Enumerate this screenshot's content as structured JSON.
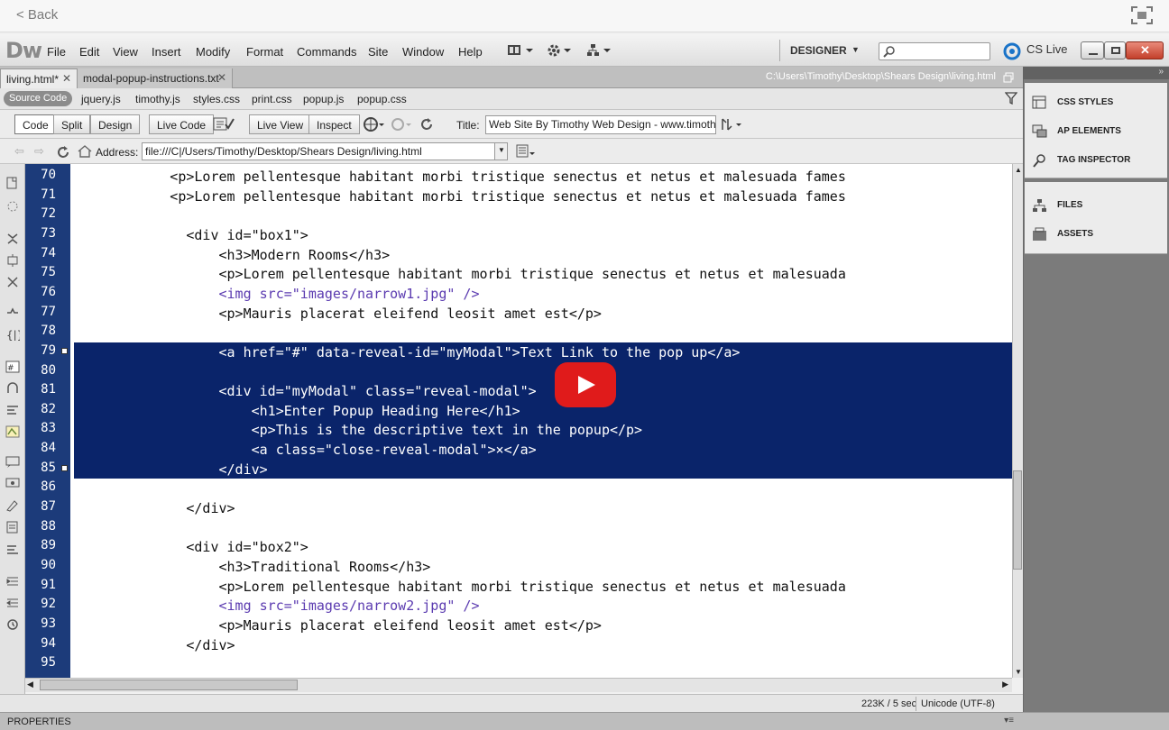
{
  "back_label": "< Back",
  "menu": [
    "File",
    "Edit",
    "View",
    "Insert",
    "Modify",
    "Format",
    "Commands",
    "Site",
    "Window",
    "Help"
  ],
  "logo": "Dw",
  "workspace": "DESIGNER",
  "cslive": "CS Live",
  "tabs": [
    {
      "label": "living.html*"
    },
    {
      "label": "modal-popup-instructions.txt"
    }
  ],
  "file_path": "C:\\Users\\Timothy\\Desktop\\Shears Design\\living.html",
  "related_files": [
    "Source Code",
    "jquery.js",
    "timothy.js",
    "styles.css",
    "print.css",
    "popup.js",
    "popup.css"
  ],
  "toolbar": {
    "code": "Code",
    "split": "Split",
    "design": "Design",
    "live_code": "Live Code",
    "live_view": "Live View",
    "inspect": "Inspect",
    "title_label": "Title:",
    "title_value": "Web Site By Timothy Web Design - www.timothywe"
  },
  "address": {
    "label": "Address:",
    "value": "file:///C|/Users/Timothy/Desktop/Shears Design/living.html"
  },
  "code_lines": [
    {
      "n": "70",
      "t": "          <p>Lorem pellentesque habitant morbi tristique senectus et netus et malesuada fames"
    },
    {
      "n": "71",
      "t": "          <p>Lorem pellentesque habitant morbi tristique senectus et netus et malesuada fames"
    },
    {
      "n": "72",
      "t": ""
    },
    {
      "n": "73",
      "t": "            <div id=\"box1\">"
    },
    {
      "n": "74",
      "t": "                <h3>Modern Rooms</h3>"
    },
    {
      "n": "75",
      "t": "                <p>Lorem pellentesque habitant morbi tristique senectus et netus et malesuada"
    },
    {
      "n": "76",
      "t": "                <img src=\"images/narrow1.jpg\" />"
    },
    {
      "n": "77",
      "t": "                <p>Mauris placerat eleifend leosit amet est</p>"
    },
    {
      "n": "78",
      "t": ""
    },
    {
      "n": "79",
      "t": "                <a href=\"#\" data-reveal-id=\"myModal\">Text Link to the pop up</a>"
    },
    {
      "n": "80",
      "t": ""
    },
    {
      "n": "81",
      "t": "                <div id=\"myModal\" class=\"reveal-modal\">"
    },
    {
      "n": "82",
      "t": "                    <h1>Enter Popup Heading Here</h1>"
    },
    {
      "n": "83",
      "t": "                    <p>This is the descriptive text in the popup</p>"
    },
    {
      "n": "84",
      "t": "                    <a class=\"close-reveal-modal\">×</a>"
    },
    {
      "n": "85",
      "t": "                </div>"
    },
    {
      "n": "86",
      "t": ""
    },
    {
      "n": "87",
      "t": "            </div>"
    },
    {
      "n": "88",
      "t": ""
    },
    {
      "n": "89",
      "t": "            <div id=\"box2\">"
    },
    {
      "n": "90",
      "t": "                <h3>Traditional Rooms</h3>"
    },
    {
      "n": "91",
      "t": "                <p>Lorem pellentesque habitant morbi tristique senectus et netus et malesuada"
    },
    {
      "n": "92",
      "t": "                <img src=\"images/narrow2.jpg\" />"
    },
    {
      "n": "93",
      "t": "                <p>Mauris placerat eleifend leosit amet est</p>"
    },
    {
      "n": "94",
      "t": "            </div>"
    },
    {
      "n": "95",
      "t": ""
    }
  ],
  "selected_lines": [
    79,
    85
  ],
  "status": {
    "size": "223K / 5 sec",
    "encoding": "Unicode (UTF-8)"
  },
  "properties_label": "PROPERTIES",
  "panels": [
    {
      "label": "CSS STYLES",
      "icon": "css-styles-icon"
    },
    {
      "label": "AP ELEMENTS",
      "icon": "ap-elements-icon"
    },
    {
      "label": "TAG INSPECTOR",
      "icon": "tag-inspector-icon"
    },
    {
      "label": "FILES",
      "icon": "files-icon"
    },
    {
      "label": "ASSETS",
      "icon": "assets-icon"
    }
  ],
  "colors": {
    "gutter": "#1c3b7a",
    "selection": "#0a246a",
    "play": "#e01b1b"
  }
}
